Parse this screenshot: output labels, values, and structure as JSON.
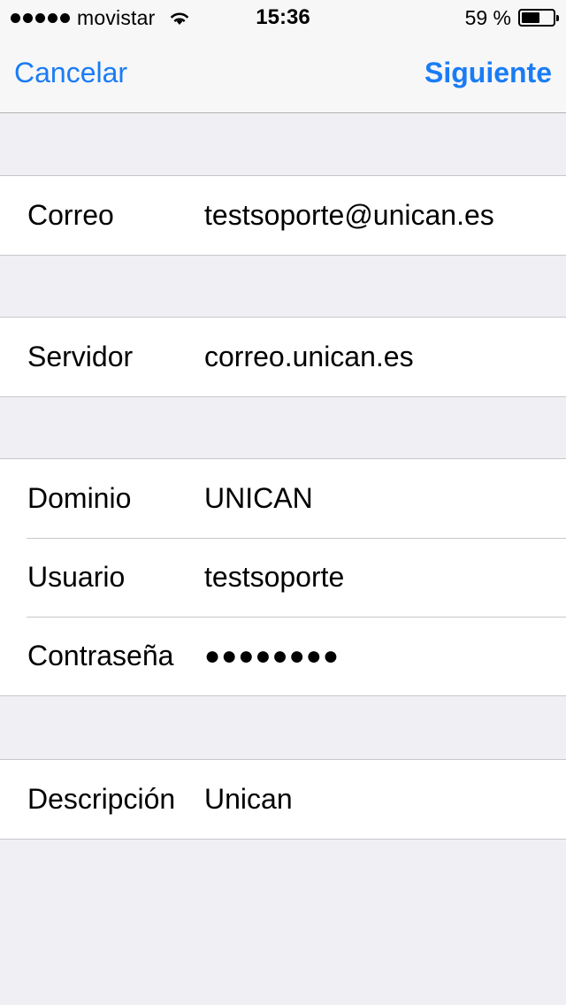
{
  "status_bar": {
    "carrier": "movistar",
    "time": "15:36",
    "battery_percent_label": "59 %",
    "battery_level": 0.59,
    "signal_bars": 5
  },
  "nav": {
    "cancel_label": "Cancelar",
    "next_label": "Siguiente"
  },
  "form": {
    "email": {
      "label": "Correo",
      "value": "testsoporte@unican.es"
    },
    "server": {
      "label": "Servidor",
      "value": "correo.unican.es"
    },
    "domain": {
      "label": "Dominio",
      "value": "UNICAN"
    },
    "user": {
      "label": "Usuario",
      "value": "testsoporte"
    },
    "password": {
      "label": "Contraseña",
      "value": "●●●●●●●●"
    },
    "description": {
      "label": "Descripción",
      "value": "Unican"
    }
  },
  "colors": {
    "accent": "#1a7cf5",
    "background": "#efeff4",
    "bar": "#f7f7f7",
    "separator": "#c8c7cc"
  },
  "icons": [
    "signal-dots-icon",
    "wifi-icon",
    "battery-icon"
  ]
}
